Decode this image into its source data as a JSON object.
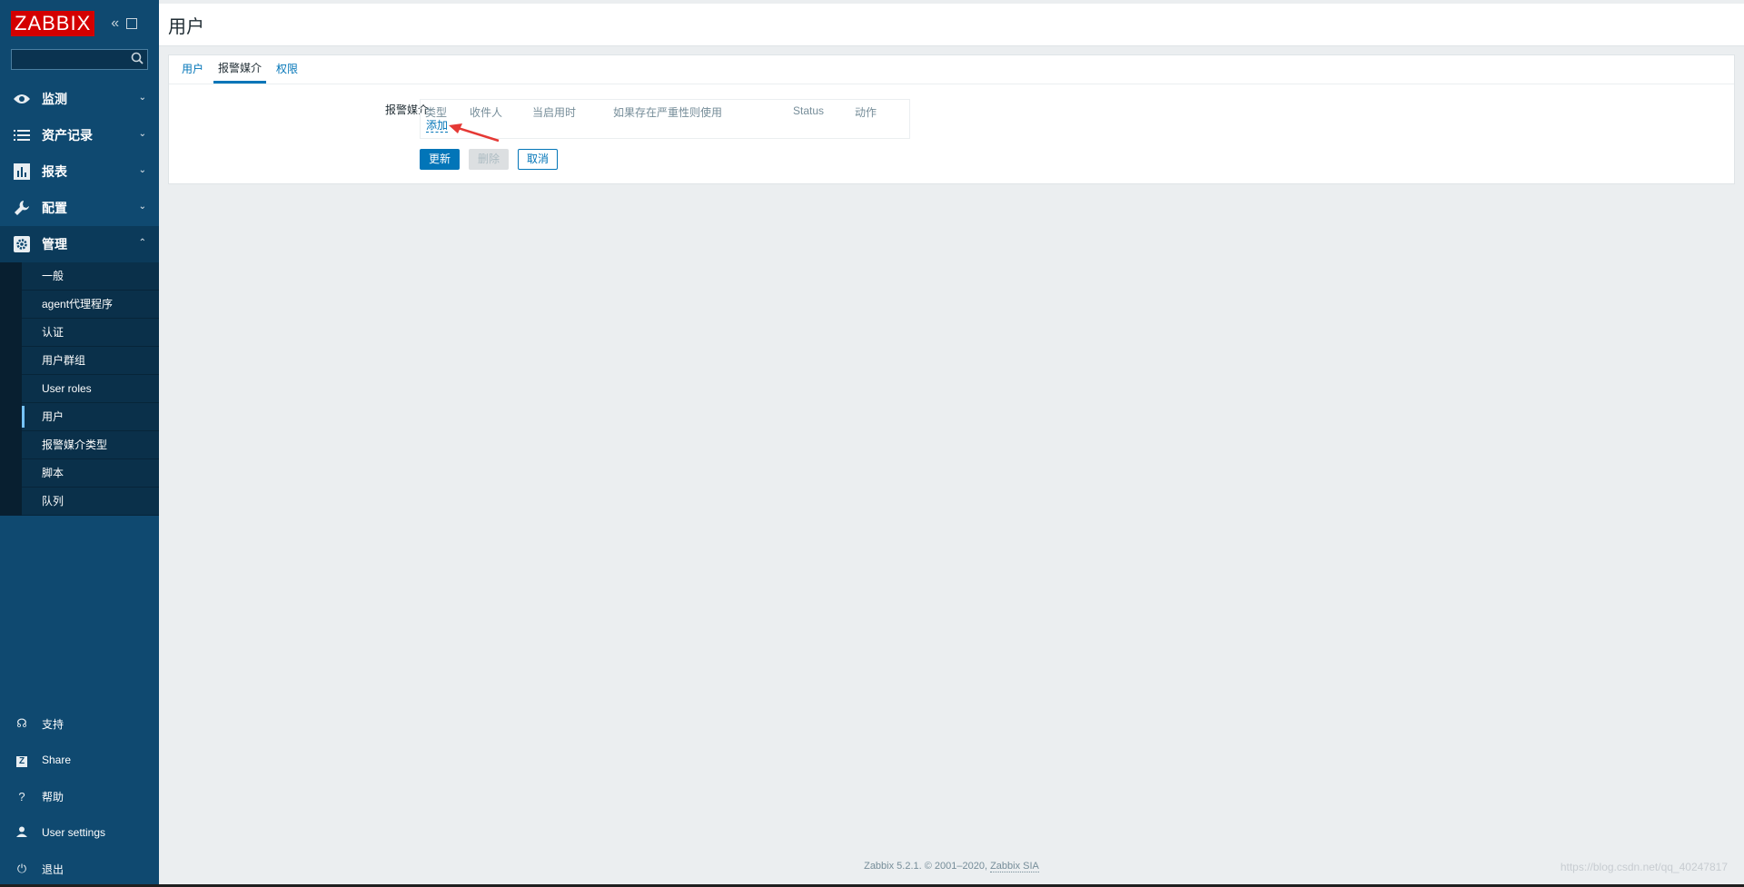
{
  "app": {
    "logo": "ZABBIX"
  },
  "page": {
    "title": "用户"
  },
  "sidebar": {
    "search_placeholder": "",
    "menu": [
      {
        "label": "监测",
        "icon": "eye-icon"
      },
      {
        "label": "资产记录",
        "icon": "list-icon"
      },
      {
        "label": "报表",
        "icon": "bar-chart-icon"
      },
      {
        "label": "配置",
        "icon": "wrench-icon"
      },
      {
        "label": "管理",
        "icon": "gear-icon"
      }
    ],
    "admin_submenu": [
      "一般",
      "agent代理程序",
      "认证",
      "用户群组",
      "User roles",
      "用户",
      "报警媒介类型",
      "脚本",
      "队列"
    ],
    "bottom": [
      {
        "label": "支持",
        "icon": "headset-icon"
      },
      {
        "label": "Share",
        "icon": "z-icon"
      },
      {
        "label": "帮助",
        "icon": "question-icon"
      },
      {
        "label": "User settings",
        "icon": "user-icon"
      },
      {
        "label": "退出",
        "icon": "power-icon"
      }
    ]
  },
  "tabs": [
    "用户",
    "报警媒介",
    "权限"
  ],
  "form": {
    "media_label": "报警媒介",
    "columns": [
      "类型",
      "收件人",
      "当启用时",
      "如果存在严重性则使用",
      "Status",
      "动作"
    ],
    "add_link": "添加"
  },
  "buttons": {
    "update": "更新",
    "delete": "删除",
    "cancel": "取消"
  },
  "footer": {
    "text": "Zabbix 5.2.1. © 2001–2020, ",
    "link": "Zabbix SIA"
  },
  "watermark": "https://blog.csdn.net/qq_40247817",
  "colors": {
    "sidebar": "#0f4970",
    "accent": "#0275b8",
    "logo": "#d40000",
    "annotation_arrow": "#e53935"
  }
}
